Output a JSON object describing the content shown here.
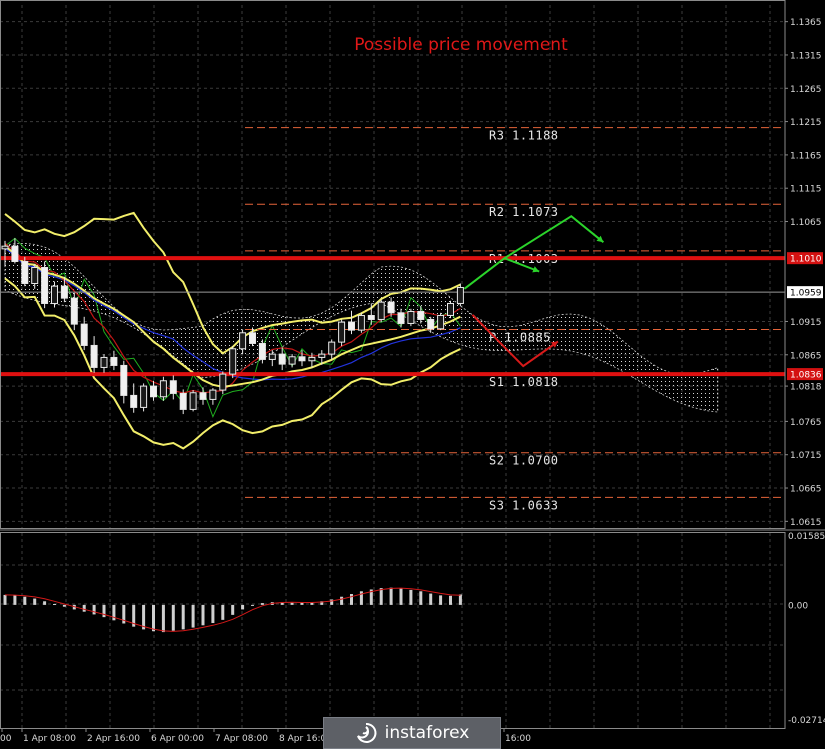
{
  "chart_data": [
    {
      "type": "candlestick",
      "title": "Possible price movement",
      "y_ticks": [
        "1.1365",
        "1.1315",
        "1.1265",
        "1.1215",
        "1.1165",
        "1.1115",
        "1.1065",
        "1.1010",
        "1.0959",
        "1.0915",
        "1.0865",
        "1.0836",
        "1.0818",
        "1.0765",
        "1.0715",
        "1.0665",
        "1.0615"
      ],
      "x_ticks": [
        "00",
        "1 Apr 08:00",
        "2 Apr 16:00",
        "6 Apr 00:00",
        "7 Apr 08:00",
        "8 Apr 16:00",
        "16:00"
      ],
      "ylim": [
        1.0605,
        1.139
      ],
      "current_price": "1.0959",
      "price_tags": [
        {
          "label": "1.1010",
          "value": 1.101,
          "color": "#d41111"
        },
        {
          "label": "1.0836",
          "value": 1.0836,
          "color": "#d41111"
        },
        {
          "label": "1.0959",
          "value": 1.0959,
          "color": "#ffffff"
        }
      ],
      "horizontal_lines": [
        {
          "value": 1.101,
          "color": "#e01010",
          "style": "solid"
        },
        {
          "value": 1.0836,
          "color": "#e01010",
          "style": "solid"
        }
      ],
      "levels": [
        {
          "label": "R3 1.1188",
          "value": 1.1188
        },
        {
          "label": "R2 1.1073",
          "value": 1.1073
        },
        {
          "label": "R1 1.1003",
          "value": 1.1003
        },
        {
          "label": "P 1.0885",
          "value": 1.0885
        },
        {
          "label": "S1 1.0818",
          "value": 1.0818
        },
        {
          "label": "S2 1.0700",
          "value": 1.07
        },
        {
          "label": "S3 1.0633",
          "value": 1.0633
        }
      ],
      "candles": [
        [
          1.1024,
          1.1036,
          1.0998,
          1.1028
        ],
        [
          1.1028,
          1.104,
          1.1002,
          1.1005
        ],
        [
          1.1005,
          1.1012,
          1.0968,
          1.0972
        ],
        [
          1.0972,
          1.1001,
          1.0964,
          1.0996
        ],
        [
          1.0996,
          1.1005,
          1.0935,
          1.0942
        ],
        [
          1.0942,
          1.0975,
          1.0936,
          1.0968
        ],
        [
          1.0968,
          1.0982,
          1.0944,
          1.095
        ],
        [
          1.095,
          1.0958,
          1.0902,
          1.0911
        ],
        [
          1.0911,
          1.0922,
          1.0872,
          1.0879
        ],
        [
          1.0879,
          1.0893,
          1.0838,
          1.0846
        ],
        [
          1.0846,
          1.0866,
          1.0838,
          1.0861
        ],
        [
          1.0861,
          1.0871,
          1.0842,
          1.0849
        ],
        [
          1.0849,
          1.0856,
          1.0792,
          1.0804
        ],
        [
          1.0804,
          1.0822,
          1.0778,
          1.0786
        ],
        [
          1.0786,
          1.0822,
          1.078,
          1.0818
        ],
        [
          1.0818,
          1.0826,
          1.0796,
          1.0802
        ],
        [
          1.0802,
          1.0832,
          1.0796,
          1.0826
        ],
        [
          1.0826,
          1.0834,
          1.0798,
          1.0807
        ],
        [
          1.0807,
          1.0813,
          1.0776,
          1.0783
        ],
        [
          1.0783,
          1.0812,
          1.078,
          1.0808
        ],
        [
          1.0808,
          1.0816,
          1.079,
          1.0798
        ],
        [
          1.0798,
          1.0815,
          1.079,
          1.0812
        ],
        [
          1.0812,
          1.084,
          1.0806,
          1.0836
        ],
        [
          1.0836,
          1.0878,
          1.083,
          1.0874
        ],
        [
          1.0874,
          1.0903,
          1.0866,
          1.0898
        ],
        [
          1.0898,
          1.0906,
          1.0878,
          1.0882
        ],
        [
          1.0882,
          1.0888,
          1.0852,
          1.0858
        ],
        [
          1.0858,
          1.0872,
          1.0848,
          1.0866
        ],
        [
          1.0866,
          1.0876,
          1.0842,
          1.0851
        ],
        [
          1.0851,
          1.0866,
          1.0846,
          1.0862
        ],
        [
          1.0862,
          1.0872,
          1.0848,
          1.0856
        ],
        [
          1.0856,
          1.0868,
          1.0846,
          1.0861
        ],
        [
          1.0861,
          1.0872,
          1.085,
          1.0866
        ],
        [
          1.0866,
          1.0888,
          1.0858,
          1.0884
        ],
        [
          1.0884,
          1.0918,
          1.0878,
          1.0914
        ],
        [
          1.0914,
          1.0931,
          1.0896,
          1.0902
        ],
        [
          1.0902,
          1.0928,
          1.0898,
          1.0924
        ],
        [
          1.0924,
          1.0942,
          1.091,
          1.0918
        ],
        [
          1.0918,
          1.0948,
          1.0914,
          1.0944
        ],
        [
          1.0944,
          1.0951,
          1.0922,
          1.0928
        ],
        [
          1.0928,
          1.0934,
          1.0906,
          1.0912
        ],
        [
          1.0912,
          1.0934,
          1.0908,
          1.093
        ],
        [
          1.093,
          1.0938,
          1.0912,
          1.0918
        ],
        [
          1.0918,
          1.0922,
          1.0898,
          1.0904
        ],
        [
          1.0904,
          1.0928,
          1.0902,
          1.0924
        ],
        [
          1.0924,
          1.0946,
          1.092,
          1.0942
        ],
        [
          1.0942,
          1.0972,
          1.0938,
          1.0966
        ]
      ],
      "forecast_arrows": [
        {
          "color": "#2bd42b",
          "points": [
            [
              1.0964,
              0
            ],
            [
              1.101,
              1.5
            ],
            [
              1.1073,
              4
            ],
            [
              1.1034,
              5.2
            ]
          ]
        },
        {
          "color": "#2bd42b",
          "points": [
            [
              1.101,
              1.5
            ],
            [
              1.099,
              2.8
            ]
          ]
        },
        {
          "color": "#d81a1a",
          "points": [
            [
              1.0925,
              0.3
            ],
            [
              1.0848,
              2.2
            ],
            [
              1.0885,
              3.5
            ]
          ]
        }
      ]
    },
    {
      "type": "bar",
      "name": "oscillator",
      "y_ticks": [
        "0.01585",
        "0.00",
        "-0.02714"
      ],
      "ylim": [
        -0.02714,
        0.01585
      ],
      "values": [
        0.0022,
        0.0021,
        0.0018,
        0.0014,
        0.0008,
        0.0002,
        -0.0004,
        -0.001,
        -0.0015,
        -0.0021,
        -0.0027,
        -0.0034,
        -0.0041,
        -0.0048,
        -0.0054,
        -0.0058,
        -0.006,
        -0.0057,
        -0.0054,
        -0.005,
        -0.0045,
        -0.004,
        -0.0033,
        -0.0022,
        -0.001,
        0.0,
        0.0004,
        0.0006,
        0.0006,
        0.0005,
        0.0005,
        0.0006,
        0.0008,
        0.0012,
        0.0018,
        0.0024,
        0.003,
        0.0034,
        0.0037,
        0.0038,
        0.0036,
        0.0033,
        0.003,
        0.0025,
        0.0021,
        0.002,
        0.0023
      ]
    }
  ],
  "logo": {
    "text": "instaforex"
  }
}
